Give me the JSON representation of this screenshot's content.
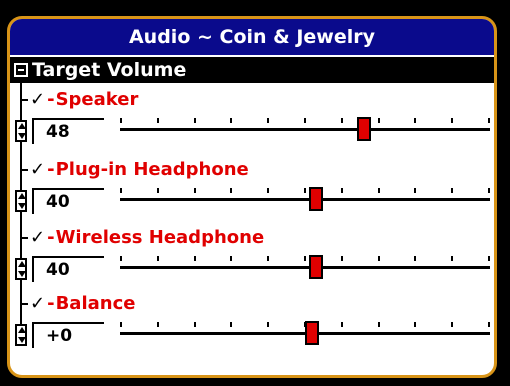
{
  "title": "Audio ~ Coin & Jewelry",
  "section": {
    "label": "Target Volume",
    "collapse_icon": "minus-box-icon"
  },
  "items": [
    {
      "label": "Speaker",
      "value": "48",
      "level": 0.66
    },
    {
      "label": "Plug-in Headphone",
      "value": "40",
      "level": 0.53
    },
    {
      "label": "Wireless Headphone",
      "value": "40",
      "level": 0.53
    },
    {
      "label": "Balance",
      "value": "+0",
      "level": 0.52
    }
  ],
  "colors": {
    "frame": "#d89418",
    "titlebar": "#0a0a8c",
    "label": "#e00000",
    "knob": "#e00000"
  }
}
